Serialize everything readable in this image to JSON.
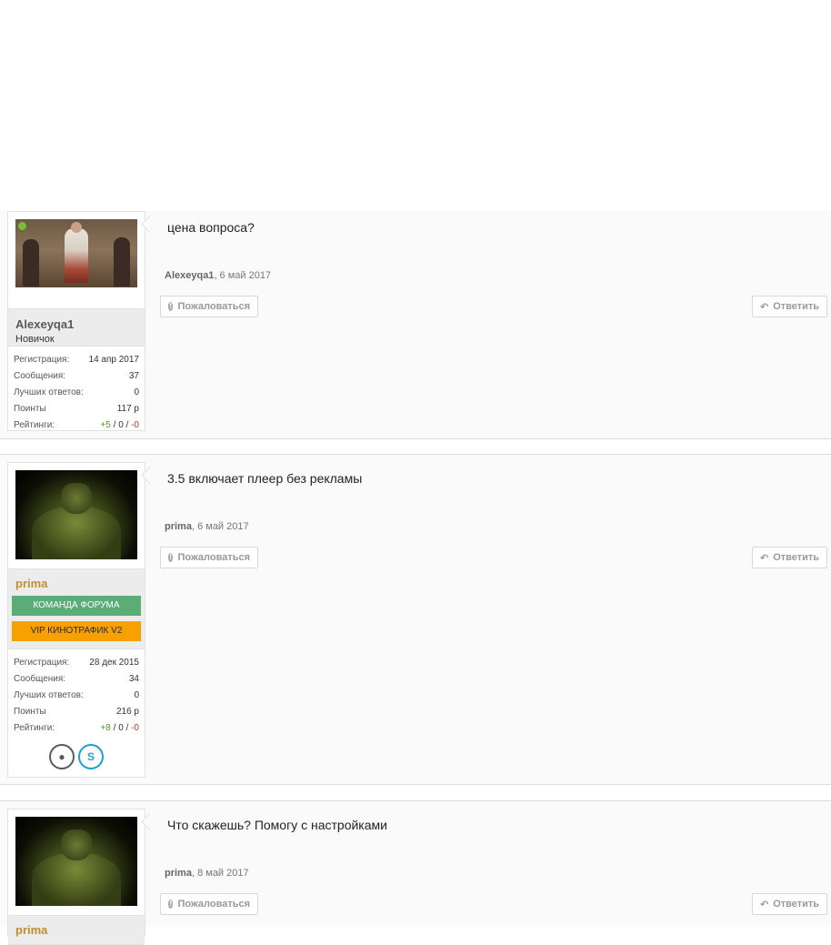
{
  "posts": [
    {
      "author": {
        "name": "Alexeyqa1",
        "rank": "Новичок"
      },
      "stats": {
        "reg_label": "Регистрация:",
        "reg_value": "14 апр 2017",
        "msg_label": "Сообщения:",
        "msg_value": "37",
        "best_label": "Лучших ответов:",
        "best_value": "0",
        "points_label": "Поинты",
        "points_value": "117 р",
        "rating_label": "Рейтинги:",
        "rating_plus": "+5",
        "rating_mid": " / 0 / ",
        "rating_minus": "-0"
      },
      "message": "цена вопроса?",
      "meta_author": "Alexeyqa1",
      "meta_date": ", 6 май 2017"
    },
    {
      "author": {
        "name": "prima",
        "badge1": "КОМАНДА ФОРУМА",
        "badge2": "VIP КИНОТРАФИК V2"
      },
      "stats": {
        "reg_label": "Регистрация:",
        "reg_value": "28 дек 2015",
        "msg_label": "Сообщения:",
        "msg_value": "34",
        "best_label": "Лучших ответов:",
        "best_value": "0",
        "points_label": "Поинты",
        "points_value": "216 р",
        "rating_label": "Рейтинги:",
        "rating_plus": "+8",
        "rating_mid": " / 0 / ",
        "rating_minus": "-0"
      },
      "message": "3.5 включает плеер без рекламы",
      "meta_author": "prima",
      "meta_date": ", 6 май 2017"
    },
    {
      "author": {
        "name": "prima"
      },
      "message": "Что скажешь? Помогу с настройками",
      "meta_author": "prima",
      "meta_date": ", 8 май 2017"
    }
  ],
  "buttons": {
    "report": "Пожаловаться",
    "reply": "Ответить"
  },
  "icons": {
    "report": "alert-icon",
    "reply": "reply-icon",
    "profile": "user-icon",
    "skype": "skype-icon"
  },
  "colors": {
    "team_badge": "#5aad77",
    "vip_badge": "#f7a100",
    "name_accent": "#c0902f",
    "rating_plus": "#5a9a1a",
    "rating_minus": "#c0392b"
  }
}
